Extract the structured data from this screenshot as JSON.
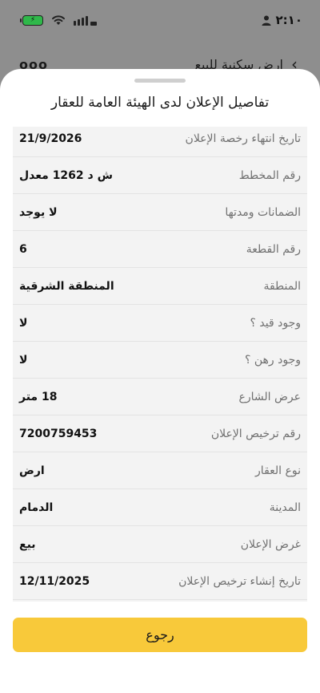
{
  "status_bar": {
    "time": "٢:١٠",
    "battery_icon": "battery-charging-icon",
    "wifi_icon": "wifi-icon",
    "signal_icon": "signal-icon",
    "person_icon": "person-icon"
  },
  "background_header": {
    "title": "ارض سكنية للبيع",
    "more_icon": "more-dots-icon",
    "dots": "ooo",
    "back_icon": "chevron-right-icon",
    "chevron": "‹"
  },
  "sheet": {
    "title": "تفاصيل الإعلان لدى الهيئة العامة للعقار",
    "rows": [
      {
        "label": "تاريخ انتهاء رخصة الإعلان",
        "value": "21/9/2026"
      },
      {
        "label": "رقم المخطط",
        "value": "ش د 1262 معدل"
      },
      {
        "label": "الضمانات ومدتها",
        "value": "لا يوجد"
      },
      {
        "label": "رقم القطعة",
        "value": "6"
      },
      {
        "label": "المنطقة",
        "value": "المنطقة الشرقية"
      },
      {
        "label": "وجود قيد ؟",
        "value": "لا"
      },
      {
        "label": "وجود رهن ؟",
        "value": "لا"
      },
      {
        "label": "عرض الشارع",
        "value": "18 متر"
      },
      {
        "label": "رقم ترخيص الإعلان",
        "value": "7200759453"
      },
      {
        "label": "نوع العقار",
        "value": "ارض"
      },
      {
        "label": "المدينة",
        "value": "الدمام"
      },
      {
        "label": "غرض الإعلان",
        "value": "بيع"
      },
      {
        "label": "تاريخ إنشاء ترخيص الإعلان",
        "value": "12/11/2025"
      }
    ],
    "back_button": "رجوع"
  },
  "colors": {
    "accent_button": "#f8c93a",
    "battery": "#2fb84a",
    "overlay": "#8e8e8e"
  }
}
